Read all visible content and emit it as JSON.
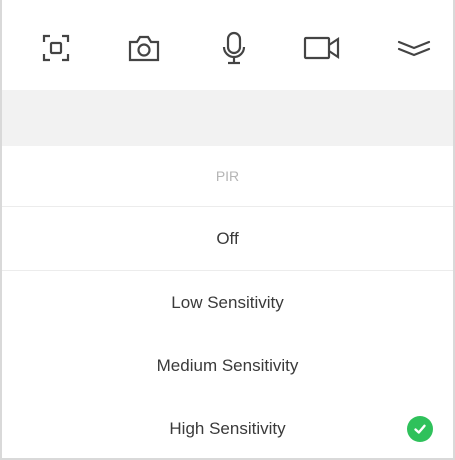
{
  "toolbar": {
    "icons": [
      "screenshot-icon",
      "camera-icon",
      "microphone-icon",
      "video-icon",
      "collapse-icon"
    ]
  },
  "sheet": {
    "title": "PIR",
    "options": [
      {
        "label": "Off",
        "selected": false
      },
      {
        "label": "Low Sensitivity",
        "selected": false
      },
      {
        "label": "Medium Sensitivity",
        "selected": false
      },
      {
        "label": "High Sensitivity",
        "selected": true
      }
    ]
  },
  "colors": {
    "accent": "#2fc15b",
    "icon": "#444444",
    "band": "#f2f2f2",
    "title": "#b5b5b5"
  }
}
